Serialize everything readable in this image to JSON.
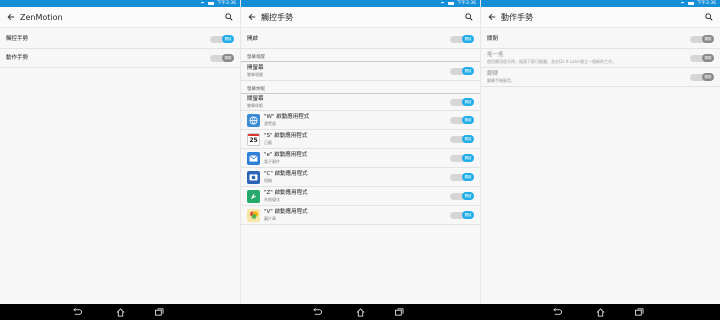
{
  "status_bar": {
    "time": "下午3:36"
  },
  "screens": [
    {
      "title": "ZenMotion",
      "rows": [
        {
          "label": "觸控手勢",
          "toggle": "開啟",
          "on": true
        },
        {
          "label": "動作手勢",
          "toggle": "關閉",
          "on": false
        }
      ]
    },
    {
      "title": "觸控手勢",
      "top_row": {
        "label": "開啟",
        "toggle": "開啟",
        "on": true
      },
      "section1": {
        "header": "螢幕喚醒",
        "row": {
          "label": "開螢幕",
          "sub": "雙擊喚醒",
          "toggle": "開啟",
          "on": true
        }
      },
      "section2": {
        "header": "螢幕休眠",
        "row": {
          "label": "關螢幕",
          "sub": "雙擊休眠",
          "toggle": "開啟",
          "on": true
        },
        "apps": [
          {
            "label": "\"W\" 啟動應用程式",
            "sub": "瀏覽器",
            "toggle": "開啟",
            "on": true,
            "icon": "globe-icon",
            "color": "#3a8ad6"
          },
          {
            "label": "\"S\" 啟動應用程式",
            "sub": "日曆",
            "toggle": "開啟",
            "on": true,
            "icon": "calendar-icon",
            "color": "#ffffff",
            "icon_text": "25"
          },
          {
            "label": "\"e\" 啟動應用程式",
            "sub": "電子郵件",
            "toggle": "開啟",
            "on": true,
            "icon": "mail-icon",
            "color": "#2f7fd8"
          },
          {
            "label": "\"C\" 啟動應用程式",
            "sub": "相機",
            "toggle": "開啟",
            "on": true,
            "icon": "camera-icon",
            "color": "#2a63b8"
          },
          {
            "label": "\"Z\" 啟動應用程式",
            "sub": "系統優化",
            "toggle": "開啟",
            "on": true,
            "icon": "rocket-icon",
            "color": "#26a96a"
          },
          {
            "label": "\"V\" 啟動應用程式",
            "sub": "圖片庫",
            "toggle": "開啟",
            "on": true,
            "icon": "gallery-icon",
            "color": "#f0c94a"
          }
        ]
      }
    },
    {
      "title": "動作手勢",
      "top_row": {
        "label": "關閉",
        "toggle": "關閉",
        "on": false
      },
      "rows": [
        {
          "label": "搖一搖",
          "sub": "使用應用程式時，搖兩下即可截圖，並在Do It Later建立一個新的工作。",
          "toggle": "關閉",
          "on": false
        },
        {
          "label": "翻轉",
          "sub": "翻轉手機靜音。",
          "toggle": "關閉",
          "on": false
        }
      ]
    }
  ],
  "colors": {
    "status_bar": "#158fd6",
    "toggle_on": "#1faee8",
    "toggle_off": "#8a8a8a"
  }
}
